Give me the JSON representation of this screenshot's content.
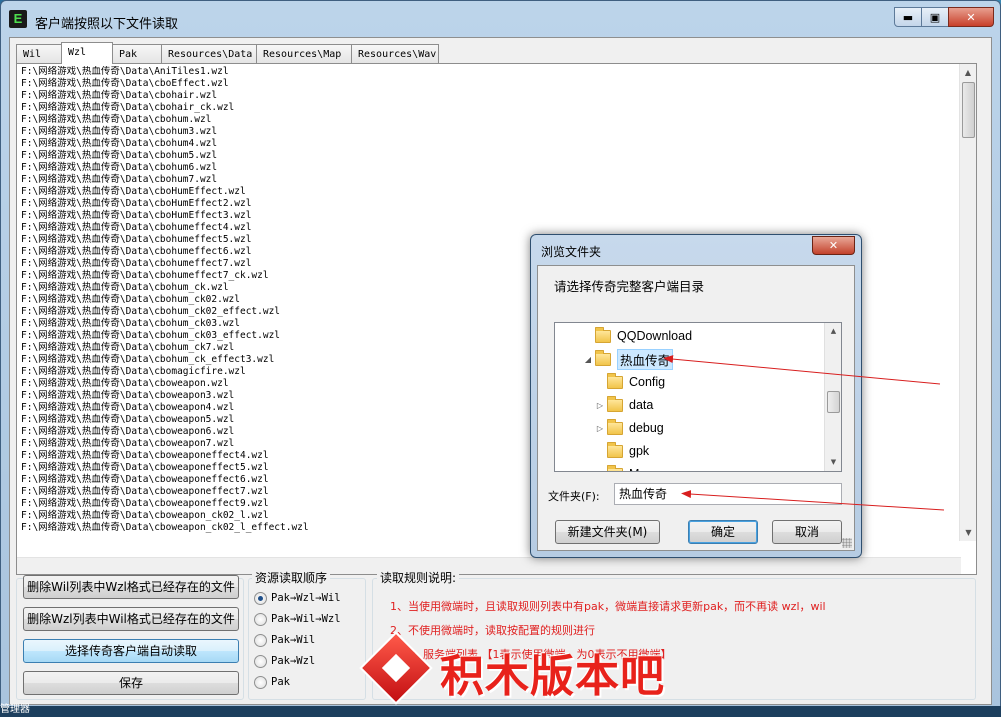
{
  "window": {
    "title": "客户端按照以下文件读取",
    "icon_letter": "E",
    "minimize_glyph": "▬",
    "maximize_glyph": "▣",
    "close_glyph": "✕"
  },
  "tabs": [
    {
      "label": "Wil"
    },
    {
      "label": "Wzl"
    },
    {
      "label": "Pak"
    },
    {
      "label": "Resources\\Data"
    },
    {
      "label": "Resources\\Map"
    },
    {
      "label": "Resources\\Wav"
    }
  ],
  "active_tab_index": 1,
  "file_list": [
    "F:\\网络游戏\\热血传奇\\Data\\AniTiles1.wzl",
    "F:\\网络游戏\\热血传奇\\Data\\cboEffect.wzl",
    "F:\\网络游戏\\热血传奇\\Data\\cbohair.wzl",
    "F:\\网络游戏\\热血传奇\\Data\\cbohair_ck.wzl",
    "F:\\网络游戏\\热血传奇\\Data\\cbohum.wzl",
    "F:\\网络游戏\\热血传奇\\Data\\cbohum3.wzl",
    "F:\\网络游戏\\热血传奇\\Data\\cbohum4.wzl",
    "F:\\网络游戏\\热血传奇\\Data\\cbohum5.wzl",
    "F:\\网络游戏\\热血传奇\\Data\\cbohum6.wzl",
    "F:\\网络游戏\\热血传奇\\Data\\cbohum7.wzl",
    "F:\\网络游戏\\热血传奇\\Data\\cboHumEffect.wzl",
    "F:\\网络游戏\\热血传奇\\Data\\cboHumEffect2.wzl",
    "F:\\网络游戏\\热血传奇\\Data\\cboHumEffect3.wzl",
    "F:\\网络游戏\\热血传奇\\Data\\cbohumeffect4.wzl",
    "F:\\网络游戏\\热血传奇\\Data\\cbohumeffect5.wzl",
    "F:\\网络游戏\\热血传奇\\Data\\cbohumeffect6.wzl",
    "F:\\网络游戏\\热血传奇\\Data\\cbohumeffect7.wzl",
    "F:\\网络游戏\\热血传奇\\Data\\cbohumeffect7_ck.wzl",
    "F:\\网络游戏\\热血传奇\\Data\\cbohum_ck.wzl",
    "F:\\网络游戏\\热血传奇\\Data\\cbohum_ck02.wzl",
    "F:\\网络游戏\\热血传奇\\Data\\cbohum_ck02_effect.wzl",
    "F:\\网络游戏\\热血传奇\\Data\\cbohum_ck03.wzl",
    "F:\\网络游戏\\热血传奇\\Data\\cbohum_ck03_effect.wzl",
    "F:\\网络游戏\\热血传奇\\Data\\cbohum_ck7.wzl",
    "F:\\网络游戏\\热血传奇\\Data\\cbohum_ck_effect3.wzl",
    "F:\\网络游戏\\热血传奇\\Data\\cbomagicfire.wzl",
    "F:\\网络游戏\\热血传奇\\Data\\cboweapon.wzl",
    "F:\\网络游戏\\热血传奇\\Data\\cboweapon3.wzl",
    "F:\\网络游戏\\热血传奇\\Data\\cboweapon4.wzl",
    "F:\\网络游戏\\热血传奇\\Data\\cboweapon5.wzl",
    "F:\\网络游戏\\热血传奇\\Data\\cboweapon6.wzl",
    "F:\\网络游戏\\热血传奇\\Data\\cboweapon7.wzl",
    "F:\\网络游戏\\热血传奇\\Data\\cboweaponeffect4.wzl",
    "F:\\网络游戏\\热血传奇\\Data\\cboweaponeffect5.wzl",
    "F:\\网络游戏\\热血传奇\\Data\\cboweaponeffect6.wzl",
    "F:\\网络游戏\\热血传奇\\Data\\cboweaponeffect7.wzl",
    "F:\\网络游戏\\热血传奇\\Data\\cboweaponeffect9.wzl",
    "F:\\网络游戏\\热血传奇\\Data\\cboweapon_ck02_l.wzl",
    "F:\\网络游戏\\热血传奇\\Data\\cboweapon_ck02_l_effect.wzl"
  ],
  "actions": {
    "delete_wil": "删除Wil列表中Wzl格式已经存在的文件",
    "delete_wzl": "删除Wzl列表中Wil格式已经存在的文件",
    "auto_read": "选择传奇客户端自动读取",
    "save": "保存"
  },
  "read_order": {
    "title": "资源读取顺序",
    "options": [
      {
        "label": "Pak→Wzl→Wil",
        "checked": true
      },
      {
        "label": "Pak→Wil→Wzl",
        "checked": false
      },
      {
        "label": "Pak→Wil",
        "checked": false
      },
      {
        "label": "Pak→Wzl",
        "checked": false
      },
      {
        "label": "Pak",
        "checked": false
      }
    ]
  },
  "rules": {
    "title": "读取规则说明:",
    "lines": [
      "1、当使用微端时，且读取规则列表中有pak，微端直接请求更新pak，而不再读 wzl，wil",
      "2、不使用微端时，读取按配置的规则进行",
      "说明：服务端列表     【1表示使用微端，为0表示不用微端】"
    ]
  },
  "watermark": {
    "text": "积木版本吧"
  },
  "dialog": {
    "title": "浏览文件夹",
    "close_glyph": "✕",
    "prompt": "请选择传奇完整客户端目录",
    "tree": [
      {
        "label": "QQDownload",
        "expander": "",
        "level": 0,
        "selected": false
      },
      {
        "label": "热血传奇",
        "expander": "◢",
        "level": 0,
        "selected": true
      },
      {
        "label": "Config",
        "expander": "",
        "level": 1,
        "selected": false
      },
      {
        "label": "data",
        "expander": "▷",
        "level": 1,
        "selected": false
      },
      {
        "label": "debug",
        "expander": "▷",
        "level": 1,
        "selected": false
      },
      {
        "label": "gpk",
        "expander": "",
        "level": 1,
        "selected": false
      },
      {
        "label": "M",
        "expander": "▷",
        "level": 1,
        "selected": false
      }
    ],
    "folder_label": "文件夹(F):",
    "folder_value": "热血传奇",
    "new_folder": "新建文件夹(M)",
    "ok": "确定",
    "cancel": "取消"
  },
  "desktop": {
    "taskbar_text": "管理器"
  },
  "colors": {
    "rule_text": "#e02020",
    "arrow": "#d81e1e",
    "watermark": "#e8221b"
  }
}
